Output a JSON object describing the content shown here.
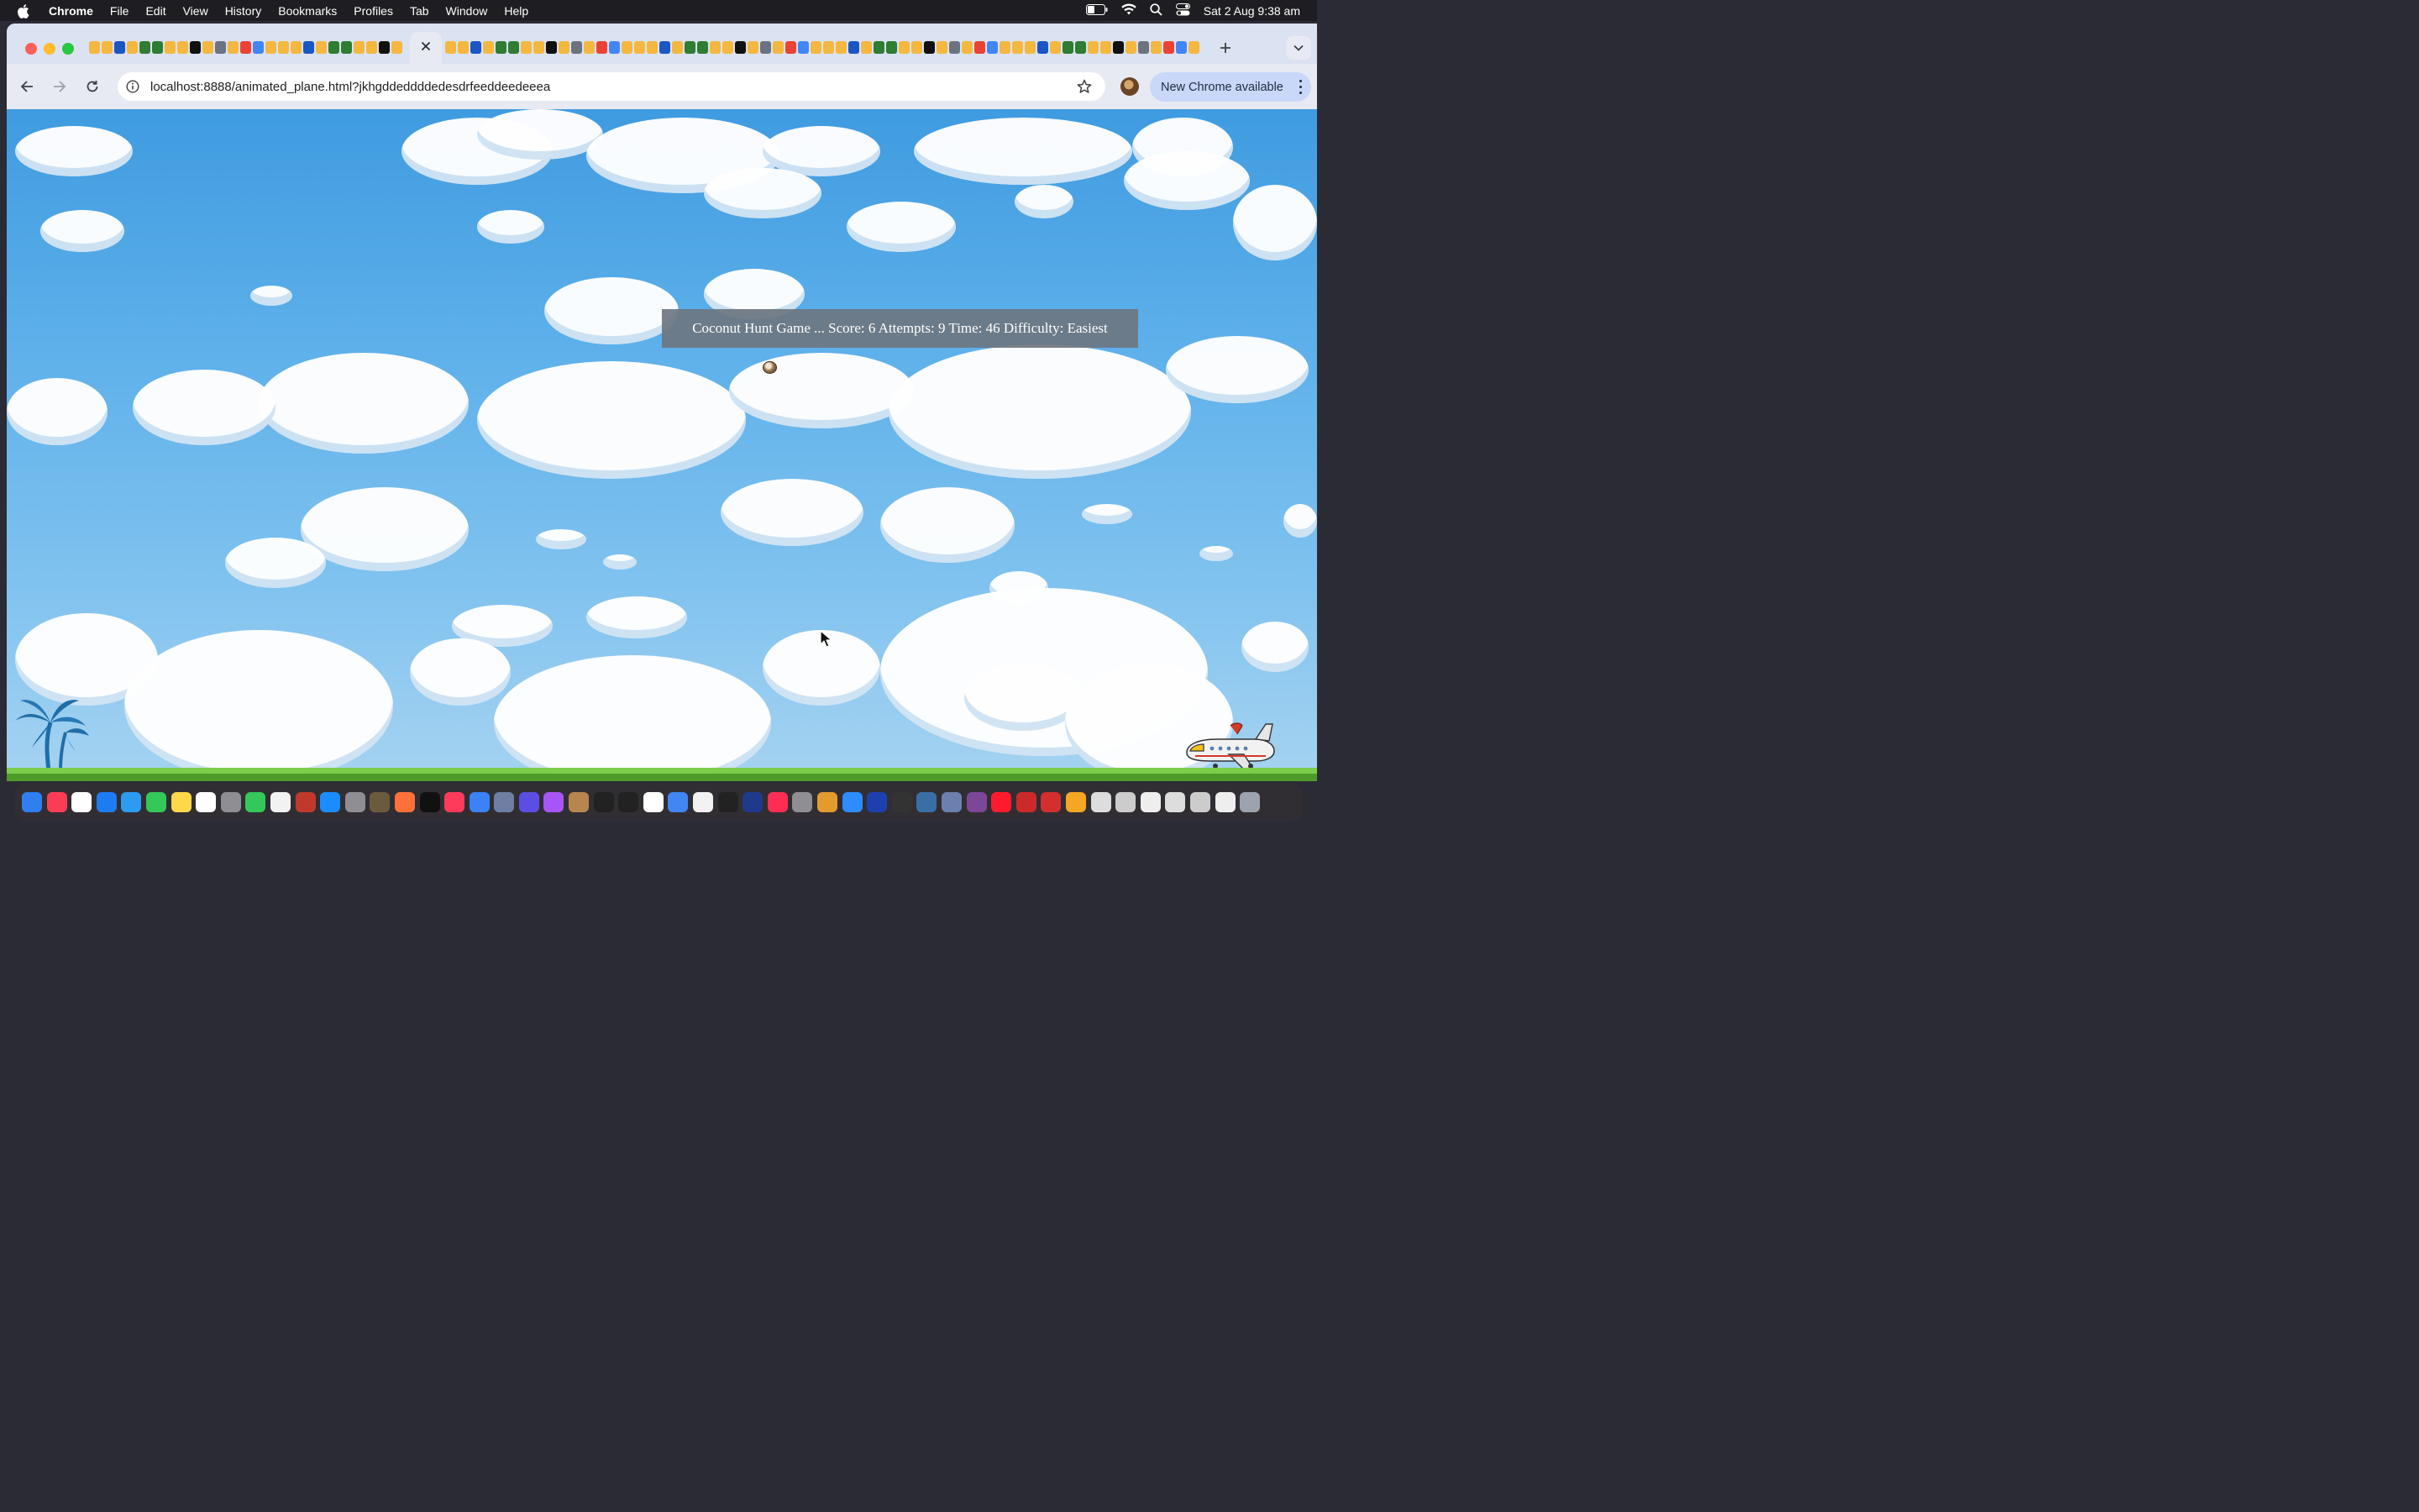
{
  "menubar": {
    "app_name": "Chrome",
    "menus": [
      "File",
      "Edit",
      "View",
      "History",
      "Bookmarks",
      "Profiles",
      "Tab",
      "Window",
      "Help"
    ],
    "clock": "Sat 2 Aug  9:38 am",
    "status_icons": [
      "battery-icon",
      "wifi-icon",
      "spotlight-search-icon",
      "control-center-icon"
    ]
  },
  "browser": {
    "url": "localhost:8888/animated_plane.html?jkhgddeddddedesdrfeeddeedeeea",
    "update_button_label": "New Chrome available",
    "tab_count_visual": "many"
  },
  "game": {
    "status_text": "Coconut Hunt Game ... Score: 6 Attempts: 9 Time: 46 Difficulty: Easiest",
    "sky_top_color": "#3f9be0",
    "sky_bottom_color": "#a6d3f1",
    "ground_color": "#7ccd4b"
  },
  "dock": {
    "icons": [
      "finder-icon",
      "music-icon",
      "reminders-icon",
      "safari-icon",
      "mail-icon",
      "messages-icon",
      "notes-icon",
      "freeform-icon",
      "launchpad-icon",
      "facetime-icon",
      "file-icon",
      "filezilla-icon",
      "app-store-icon",
      "calculator-icon",
      "gimp-icon",
      "firefox-icon",
      "apple-tv-icon",
      "news-icon",
      "no-entry-icon",
      "preview-icon",
      "bbedit-icon",
      "podcasts-icon",
      "archive-icon",
      "terminal-icon",
      "terminal-2-icon",
      "calendar-icon",
      "chrome-icon",
      "document-icon",
      "console-icon",
      "quicktime-icon",
      "intellij-icon",
      "system-settings-icon",
      "color-picker-icon",
      "zoom-icon",
      "vectorworks-icon",
      "inkscape-icon",
      "postgres-icon",
      "editor-icon",
      "tor-icon",
      "opera-icon",
      "compass-icon",
      "photo-booth-icon",
      "keynote-icon",
      "file-thumb-1-icon",
      "file-thumb-2-icon",
      "file-thumb-3-icon",
      "file-thumb-4-icon",
      "file-thumb-5-icon",
      "file-thumb-6-icon",
      "trash-icon"
    ]
  }
}
